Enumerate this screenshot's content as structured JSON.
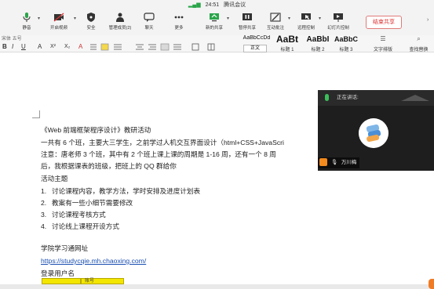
{
  "meeting": {
    "time": "24:51",
    "app_name": "腾讯会议",
    "buttons": [
      {
        "label": "静音",
        "icon": "microphone-icon"
      },
      {
        "label": "开启视频",
        "icon": "camera-off-icon"
      },
      {
        "label": "安全",
        "icon": "shield-icon"
      },
      {
        "label": "管理成员(2)",
        "icon": "people-icon"
      },
      {
        "label": "聊天",
        "icon": "chat-icon"
      },
      {
        "label": "更多",
        "icon": "more-icon"
      },
      {
        "label": "新的共享",
        "icon": "share-screen-icon"
      },
      {
        "label": "暂停共享",
        "icon": "pause-icon"
      },
      {
        "label": "互动批注",
        "icon": "annotate-icon"
      },
      {
        "label": "远程控制",
        "icon": "remote-control-icon"
      },
      {
        "label": "幻灯片控制",
        "icon": "slides-icon"
      }
    ],
    "end_share_label": "结束共享",
    "colors": {
      "accent_green": "#2aa54a",
      "end_red": "#d33333",
      "panel_dark": "#1e1e1e"
    }
  },
  "ribbon": {
    "row1_text": "宋体        五号",
    "format_buttons": [
      "B",
      "I",
      "U",
      "A",
      "X²",
      "X₂",
      "A"
    ],
    "styles": [
      {
        "preview": "AaBbCcDd",
        "name": "正文"
      },
      {
        "preview": "AaBt",
        "name": "标题 1"
      },
      {
        "preview": "AaBbI",
        "name": "标题 2"
      },
      {
        "preview": "AaBbC",
        "name": "标题 3"
      }
    ],
    "text_layout_label": "文字排版",
    "find_replace_label": "查找替换"
  },
  "document": {
    "lines": [
      "《Web 前端框架程序设计》教研活动",
      "一共有 6 个班，主要大三学生，之前学过人机交互界面设计（html+CSS+JavaScri",
      "注意：唐老师 3 个班，其中有 2 个班上课上课的周期是 1-16 周，还有一个 8 周",
      "后，我根据课表的班级，把班上的 QQ 群给你",
      "活动主题"
    ],
    "list": [
      "讨论课程内容，教学方法，学时安排及进度计划表",
      "教案有一些小细节需要修改",
      "讨论课程考核方式",
      "讨论线上课程开设方式"
    ],
    "site_title": "学院学习通网址",
    "site_url": "https://studycqie.mh.chaoxing.com/",
    "login_label": "登录用户名",
    "table_cell": "账号"
  },
  "video_panel": {
    "speaking_label": "正在讲话:",
    "participant_name": "万川梅"
  }
}
